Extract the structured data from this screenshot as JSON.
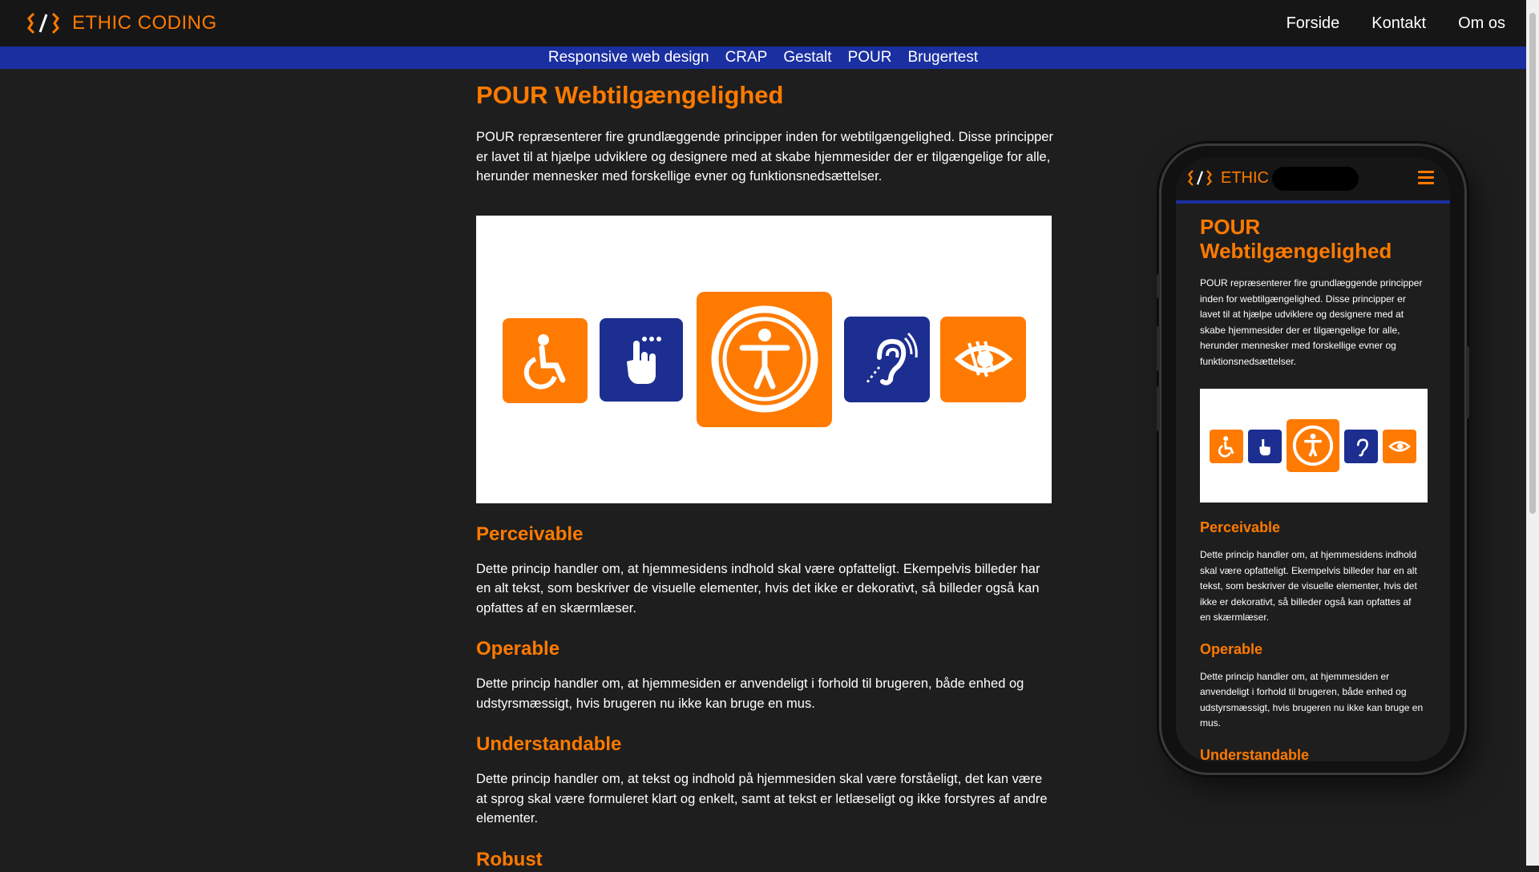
{
  "header": {
    "brand": "ETHIC CODING",
    "nav": [
      "Forside",
      "Kontakt",
      "Om os"
    ]
  },
  "subnav": [
    "Responsive web design",
    "CRAP",
    "Gestalt",
    "POUR",
    "Brugertest"
  ],
  "main": {
    "title": "POUR Webtilgængelighed",
    "intro": "POUR repræsenterer fire grundlæggende principper inden for webtilgængelighed. Disse principper er lavet til at hjælpe udviklere og designere med at skabe hjemmesider der er tilgængelige for alle, herunder mennesker med forskellige evner og funktionsnedsættelser.",
    "sections": [
      {
        "heading": "Perceivable",
        "text": "Dette princip handler om, at hjemmesidens indhold skal være opfatteligt. Ekempelvis billeder har en alt tekst, som beskriver de visuelle elementer, hvis det ikke er dekorativt, så billeder også kan opfattes af en skærmlæser."
      },
      {
        "heading": "Operable",
        "text": "Dette princip handler om, at hjemmesiden er anvendeligt i forhold til brugeren, både enhed og udstyrsmæssigt, hvis brugeren nu ikke kan bruge en mus."
      },
      {
        "heading": "Understandable",
        "text": "Dette princip handler om, at tekst og indhold på hjemmesiden skal være forståeligt, det kan være at sprog skal være formuleret klart og enkelt, samt at tekst er letlæseligt og ikke forstyres af andre elementer."
      },
      {
        "heading": "Robust"
      }
    ]
  },
  "phone": {
    "brand": "ETHIC",
    "title": "POUR Webtilgængelighed",
    "intro": "POUR repræsenterer fire grundlæggende principper inden for webtilgængelighed. Disse principper er lavet til at hjælpe udviklere og designere med at skabe hjemmesider der er tilgængelige for alle, herunder mennesker med forskellige evner og funktionsnedsættelser.",
    "sections": [
      {
        "heading": "Perceivable",
        "text": "Dette princip handler om, at hjemmesidens indhold skal være opfatteligt. Ekempelvis billeder har en alt tekst, som beskriver de visuelle elementer, hvis det ikke er dekorativt, så billeder også kan opfattes af en skærmlæser."
      },
      {
        "heading": "Operable",
        "text": "Dette princip handler om, at hjemmesiden er anvendeligt i forhold til brugeren, både enhed og udstyrsmæssigt, hvis brugeren nu ikke kan bruge en mus."
      },
      {
        "heading": "Understandable"
      }
    ]
  },
  "icons": [
    "code-logo-icon",
    "wheelchair-icon",
    "touch-hand-icon",
    "universal-access-icon",
    "hearing-assist-icon",
    "low-vision-icon",
    "hamburger-menu-icon"
  ],
  "colors": {
    "accent": "#ff7a00",
    "nav_blue": "#1a2fa0",
    "icon_blue": "#1c2e8f",
    "background": "#1e1e1e"
  }
}
